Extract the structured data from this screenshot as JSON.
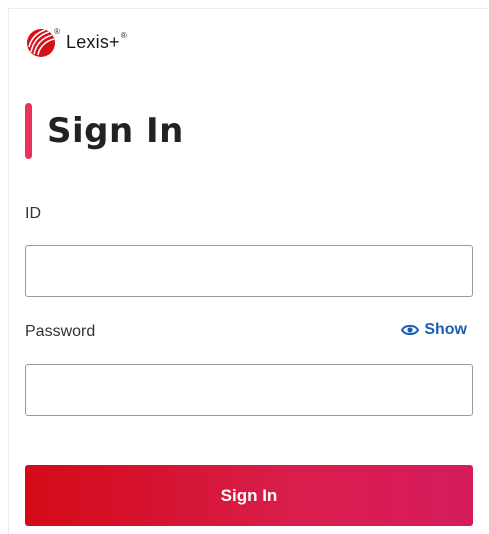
{
  "brand": {
    "name": "Lexis+",
    "mark": "®",
    "logo_icon": "lexis-tree-logo-icon",
    "accent_color": "#e8315d"
  },
  "page": {
    "title": "Sign In"
  },
  "form": {
    "id_label": "ID",
    "id_value": "",
    "password_label": "Password",
    "password_value": "",
    "show_label": "Show",
    "show_icon": "eye-icon",
    "submit_label": "Sign In",
    "submit_color_start": "#d40a16",
    "submit_color_end": "#d61b5d",
    "link_color": "#1c5fb4"
  }
}
